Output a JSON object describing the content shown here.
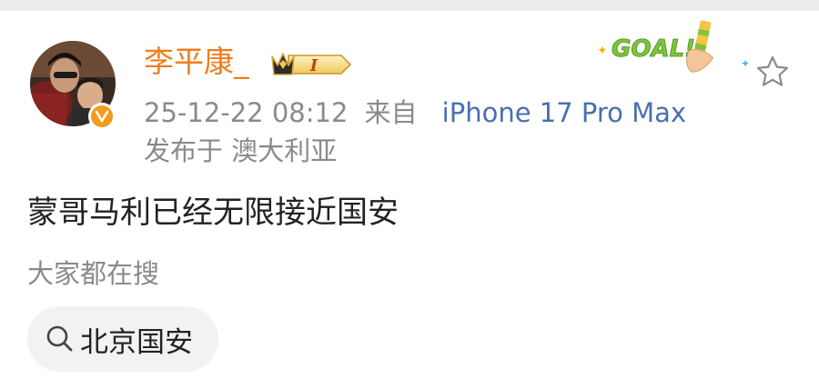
{
  "header": {
    "username": "李平康_",
    "vip_level": "I",
    "timestamp": "25-12-22 08:12",
    "via_label": "来自",
    "device": "iPhone 17 Pro Max",
    "location": "发布于 澳大利亚"
  },
  "decoration": {
    "goal_text": "GOAL!"
  },
  "post": {
    "text": "蒙哥马利已经无限接近国安"
  },
  "search": {
    "hint_label": "大家都在搜",
    "chip_label": "北京国安"
  },
  "colors": {
    "username": "#ef7e1c",
    "device_link": "#4a6fae",
    "muted_text": "#8a8a8a",
    "verify_badge": "#f39b1c",
    "goal_green": "#7cc63a"
  }
}
